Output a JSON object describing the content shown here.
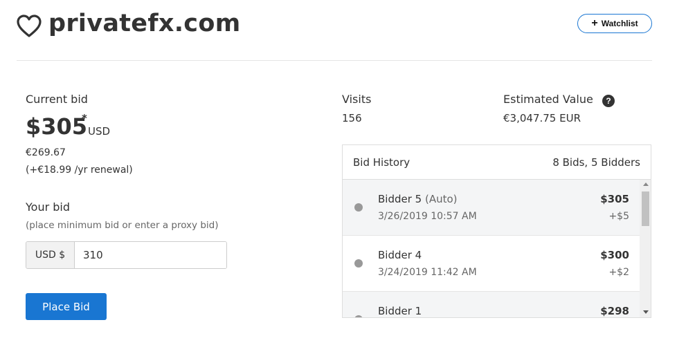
{
  "header": {
    "domain": "privatefx.com",
    "watchlist_label": "Watchlist",
    "watchlist_icon": "plus-icon",
    "favorite_icon": "heart-outline-icon"
  },
  "bid": {
    "current_label": "Current bid",
    "amount": "$305",
    "star": "*",
    "currency": "USD",
    "eur_amount": "€269.67",
    "renewal": "(+€18.99 /yr renewal)"
  },
  "your_bid": {
    "label": "Your bid",
    "hint": "(place minimum bid or enter a proxy bid)",
    "prefix": "USD $",
    "value": "310",
    "button": "Place Bid"
  },
  "stats": {
    "visits_label": "Visits",
    "visits_value": "156",
    "estimated_label": "Estimated Value",
    "estimated_value": "€3,047.75 EUR",
    "help_icon": "question-circle-icon"
  },
  "history": {
    "title": "Bid History",
    "summary": "8 Bids, 5 Bidders",
    "rows": [
      {
        "name": "Bidder 5",
        "auto": " (Auto)",
        "date": "3/26/2019 10:57 AM",
        "amount": "$305",
        "increment": "+$5"
      },
      {
        "name": "Bidder 4",
        "auto": "",
        "date": "3/24/2019 11:42 AM",
        "amount": "$300",
        "increment": "+$2"
      },
      {
        "name": "Bidder 1",
        "auto": "",
        "date": "",
        "amount": "$298",
        "increment": ""
      }
    ]
  },
  "colors": {
    "accent": "#1976d2",
    "row_alt": "#f4f5f6",
    "text": "#333333",
    "muted": "#666666"
  }
}
